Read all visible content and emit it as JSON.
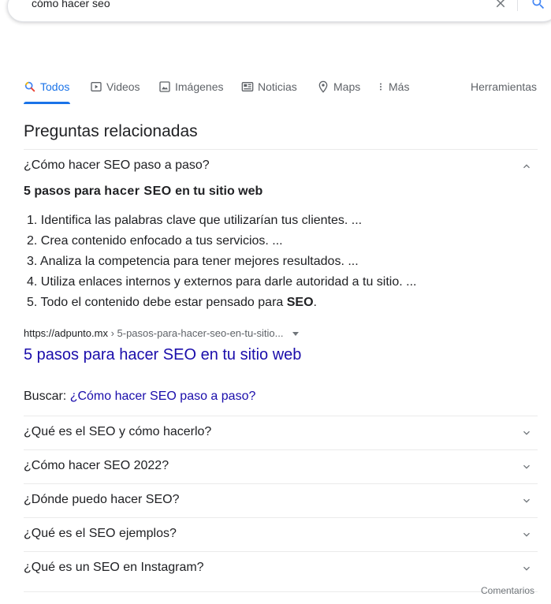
{
  "search": {
    "query": "cómo hacer seo"
  },
  "tabs": [
    {
      "label": "Todos",
      "icon": "search-icon"
    },
    {
      "label": "Videos",
      "icon": "play-icon"
    },
    {
      "label": "Imágenes",
      "icon": "image-icon"
    },
    {
      "label": "Noticias",
      "icon": "news-icon"
    },
    {
      "label": "Maps",
      "icon": "map-pin-icon"
    },
    {
      "label": "Más",
      "icon": "more-vert-icon"
    }
  ],
  "tools_label": "Herramientas",
  "paa": {
    "title": "Preguntas relacionadas",
    "expanded": {
      "question": "¿Cómo hacer SEO paso a paso?",
      "answer_prefix": "5 pasos para ",
      "answer_bold": "hacer SEO",
      "answer_suffix": " en tu sitio web",
      "steps": [
        "1. Identifica las palabras clave que utilizarían tus clientes. ...",
        "2. Crea contenido enfocado a tus servicios. ...",
        "3. Analiza la competencia para tener mejores resultados. ...",
        "4. Utiliza enlaces internos y externos para darle autoridad a tu sitio. ...",
        "5. Todo el contenido debe estar pensado para "
      ],
      "last_step_bold": "SEO",
      "last_step_end": ".",
      "cite_domain": "https://adpunto.mx",
      "cite_path": " › 5-pasos-para-hacer-seo-en-tu-sitio...",
      "result_title": "5 pasos para hacer SEO en tu sitio web",
      "search_prefix": "Buscar: ",
      "search_link": "¿Cómo hacer SEO paso a paso?"
    },
    "questions": [
      "¿Qué es el SEO y cómo hacerlo?",
      "¿Cómo hacer SEO 2022?",
      "¿Dónde puedo hacer SEO?",
      "¿Qué es el SEO ejemplos?",
      "¿Qué es un SEO en Instagram?"
    ]
  },
  "feedback_label": "Comentarios",
  "colors": {
    "accent": "#1a73e8",
    "link": "#1a0dab",
    "text": "#202124",
    "muted": "#5f6368"
  }
}
